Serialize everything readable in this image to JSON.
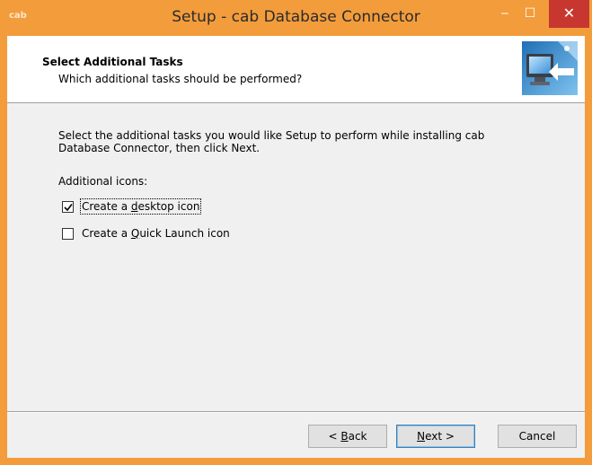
{
  "window": {
    "app_icon_text": "cab",
    "title": "Setup - cab Database Connector",
    "minimize_glyph": "‒",
    "maximize_glyph": "☐",
    "close_glyph": "✕"
  },
  "header": {
    "title": "Select Additional Tasks",
    "subtitle": "Which additional tasks should be performed?",
    "image_icon": "computer-install-icon"
  },
  "content": {
    "description": "Select the additional tasks you would like Setup to perform while installing cab Database Connector, then click Next.",
    "group_label": "Additional icons:",
    "tasks": [
      {
        "label_pre": "Create a ",
        "label_accel": "d",
        "label_post": "esktop icon",
        "checked": true
      },
      {
        "label_pre": "Create a ",
        "label_accel": "Q",
        "label_post": "uick Launch icon",
        "checked": false
      }
    ]
  },
  "buttons": {
    "back_pre": "< ",
    "back_accel": "B",
    "back_post": "ack",
    "next_accel": "N",
    "next_post": "ext >",
    "cancel": "Cancel"
  },
  "colors": {
    "titlebar": "#f39c3c",
    "close_button": "#c7372f",
    "dialog_bg": "#f0f0f0"
  }
}
